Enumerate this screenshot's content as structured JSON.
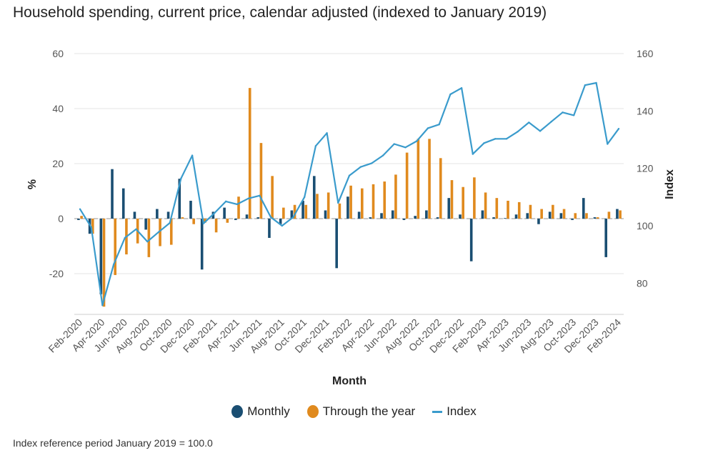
{
  "chart_data": {
    "type": "bar+line",
    "title": "Household spending, current price, calendar adjusted (indexed to January 2019)",
    "xlabel": "Month",
    "ylabel_left": "%",
    "ylabel_right": "Index",
    "ylim_left": [
      -35,
      60
    ],
    "yticks_left": [
      60,
      40,
      20,
      0,
      -20
    ],
    "ylim_right": [
      70,
      160
    ],
    "yticks_right": [
      160,
      140,
      120,
      100,
      80
    ],
    "grid": true,
    "legend_position": "bottom",
    "categories": [
      "Feb-2020",
      "Mar-2020",
      "Apr-2020",
      "May-2020",
      "Jun-2020",
      "Jul-2020",
      "Aug-2020",
      "Sep-2020",
      "Oct-2020",
      "Nov-2020",
      "Dec-2020",
      "Jan-2021",
      "Feb-2021",
      "Mar-2021",
      "Apr-2021",
      "May-2021",
      "Jun-2021",
      "Jul-2021",
      "Aug-2021",
      "Sep-2021",
      "Oct-2021",
      "Nov-2021",
      "Dec-2021",
      "Jan-2022",
      "Feb-2022",
      "Mar-2022",
      "Apr-2022",
      "May-2022",
      "Jun-2022",
      "Jul-2022",
      "Aug-2022",
      "Sep-2022",
      "Oct-2022",
      "Nov-2022",
      "Dec-2022",
      "Jan-2023",
      "Feb-2023",
      "Mar-2023",
      "Apr-2023",
      "May-2023",
      "Jun-2023",
      "Jul-2023",
      "Aug-2023",
      "Sep-2023",
      "Oct-2023",
      "Nov-2023",
      "Dec-2023",
      "Jan-2024",
      "Feb-2024"
    ],
    "xtick_labels": [
      "Feb-2020",
      "Apr-2020",
      "Jun-2020",
      "Aug-2020",
      "Oct-2020",
      "Dec-2020",
      "Feb-2021",
      "Apr-2021",
      "Jun-2021",
      "Aug-2021",
      "Oct-2021",
      "Dec-2021",
      "Feb-2022",
      "Apr-2022",
      "Jun-2022",
      "Aug-2022",
      "Oct-2022",
      "Dec-2022",
      "Feb-2023",
      "Apr-2023",
      "Jun-2023",
      "Aug-2023",
      "Oct-2023",
      "Dec-2023",
      "Feb-2024"
    ],
    "series": [
      {
        "name": "Monthly",
        "type": "bar",
        "axis": "left",
        "color": "#1a4e72",
        "values": [
          -0.5,
          -5.5,
          -27.5,
          18,
          11,
          2.5,
          -4,
          3.5,
          2.5,
          14.5,
          6.5,
          -18.5,
          2.5,
          4,
          -0.5,
          1.5,
          0.5,
          -7,
          -2,
          3,
          6.5,
          15.5,
          3,
          -18,
          8,
          2.5,
          0.5,
          2,
          3,
          -0.5,
          1,
          3,
          0.5,
          7.5,
          1.5,
          -15.5,
          3,
          0.5,
          0.2,
          1.5,
          2,
          -2,
          2.5,
          2,
          -0.5,
          7.5,
          0.5,
          -14,
          3.5
        ]
      },
      {
        "name": "Through the year",
        "type": "bar",
        "axis": "left",
        "color": "#e08a1e",
        "values": [
          1,
          -5.5,
          -32,
          -20.5,
          -13,
          -9,
          -14,
          -10,
          -9.5,
          0.5,
          -2,
          -1.5,
          -5,
          -1.5,
          8,
          47.5,
          27.5,
          15.5,
          4,
          5,
          5,
          9,
          9.5,
          5.5,
          12,
          11,
          12.5,
          13.5,
          16,
          24,
          29,
          29,
          22,
          14,
          11.5,
          15,
          9.5,
          7.5,
          6.5,
          6,
          5,
          3.5,
          5,
          3.5,
          2,
          2,
          0.5,
          2.5,
          3
        ]
      },
      {
        "name": "Index",
        "type": "line",
        "axis": "right",
        "color": "#3a9bcc",
        "values": [
          105.8,
          99.5,
          72.3,
          86.5,
          95.8,
          98.8,
          94.5,
          97.8,
          101,
          116.5,
          124.5,
          100.8,
          104.5,
          108.5,
          107.5,
          109.5,
          110.5,
          103,
          100,
          103,
          110,
          127.8,
          132.3,
          108,
          117.5,
          120.5,
          121.8,
          124.5,
          128.5,
          127.3,
          129.5,
          134,
          135.3,
          145.8,
          148,
          125,
          128.8,
          130.3,
          130.3,
          132.8,
          136,
          133,
          136.3,
          139.5,
          138.5,
          149,
          149.8,
          128.5,
          133.8
        ]
      }
    ]
  },
  "legend": {
    "items": [
      {
        "label": "Monthly",
        "color": "#1a4e72",
        "shape": "dot"
      },
      {
        "label": "Through the year",
        "color": "#e08a1e",
        "shape": "dot"
      },
      {
        "label": "Index",
        "color": "#3a9bcc",
        "shape": "line"
      }
    ]
  },
  "footnote": "Index reference period January 2019 = 100.0"
}
